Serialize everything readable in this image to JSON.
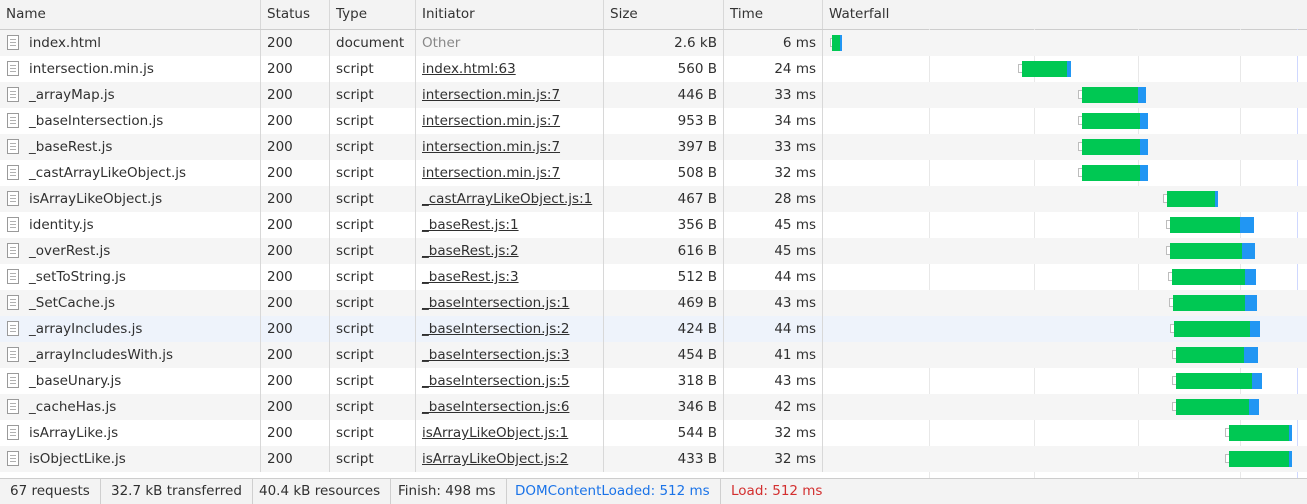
{
  "columns": {
    "name": "Name",
    "status": "Status",
    "type": "Type",
    "initiator": "Initiator",
    "size": "Size",
    "time": "Time",
    "waterfall": "Waterfall"
  },
  "rows": [
    {
      "name": "index.html",
      "status": "200",
      "type": "document",
      "initiator": "Other",
      "size": "2.6 kB",
      "time": "6 ms"
    },
    {
      "name": "intersection.min.js",
      "status": "200",
      "type": "script",
      "initiator": "index.html:63",
      "size": "560 B",
      "time": "24 ms"
    },
    {
      "name": "_arrayMap.js",
      "status": "200",
      "type": "script",
      "initiator": "intersection.min.js:7",
      "size": "446 B",
      "time": "33 ms"
    },
    {
      "name": "_baseIntersection.js",
      "status": "200",
      "type": "script",
      "initiator": "intersection.min.js:7",
      "size": "953 B",
      "time": "34 ms"
    },
    {
      "name": "_baseRest.js",
      "status": "200",
      "type": "script",
      "initiator": "intersection.min.js:7",
      "size": "397 B",
      "time": "33 ms"
    },
    {
      "name": "_castArrayLikeObject.js",
      "status": "200",
      "type": "script",
      "initiator": "intersection.min.js:7",
      "size": "508 B",
      "time": "32 ms"
    },
    {
      "name": "isArrayLikeObject.js",
      "status": "200",
      "type": "script",
      "initiator": "_castArrayLikeObject.js:1",
      "size": "467 B",
      "time": "28 ms"
    },
    {
      "name": "identity.js",
      "status": "200",
      "type": "script",
      "initiator": "_baseRest.js:1",
      "size": "356 B",
      "time": "45 ms"
    },
    {
      "name": "_overRest.js",
      "status": "200",
      "type": "script",
      "initiator": "_baseRest.js:2",
      "size": "616 B",
      "time": "45 ms"
    },
    {
      "name": "_setToString.js",
      "status": "200",
      "type": "script",
      "initiator": "_baseRest.js:3",
      "size": "512 B",
      "time": "44 ms"
    },
    {
      "name": "_SetCache.js",
      "status": "200",
      "type": "script",
      "initiator": "_baseIntersection.js:1",
      "size": "469 B",
      "time": "43 ms"
    },
    {
      "name": "_arrayIncludes.js",
      "status": "200",
      "type": "script",
      "initiator": "_baseIntersection.js:2",
      "size": "424 B",
      "time": "44 ms"
    },
    {
      "name": "_arrayIncludesWith.js",
      "status": "200",
      "type": "script",
      "initiator": "_baseIntersection.js:3",
      "size": "454 B",
      "time": "41 ms"
    },
    {
      "name": "_baseUnary.js",
      "status": "200",
      "type": "script",
      "initiator": "_baseIntersection.js:5",
      "size": "318 B",
      "time": "43 ms"
    },
    {
      "name": "_cacheHas.js",
      "status": "200",
      "type": "script",
      "initiator": "_baseIntersection.js:6",
      "size": "346 B",
      "time": "42 ms"
    },
    {
      "name": "isArrayLike.js",
      "status": "200",
      "type": "script",
      "initiator": "isArrayLikeObject.js:1",
      "size": "544 B",
      "time": "32 ms"
    },
    {
      "name": "isObjectLike.js",
      "status": "200",
      "type": "script",
      "initiator": "isArrayLikeObject.js:2",
      "size": "433 B",
      "time": "32 ms"
    }
  ],
  "footer": {
    "requests": "67 requests",
    "transferred": "32.7 kB transferred",
    "resources": "40.4 kB resources",
    "finish": "Finish: 498 ms",
    "dcl": "DOMContentLoaded: 512 ms",
    "load": "Load: 512 ms"
  },
  "colors": {
    "download": "#00c853",
    "content": "#2196f3",
    "dcl": "#1a73e8",
    "load": "#d32f2f"
  }
}
